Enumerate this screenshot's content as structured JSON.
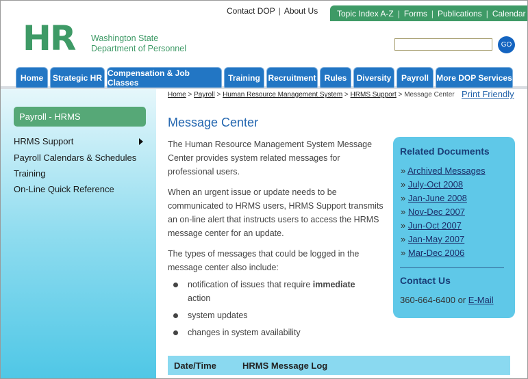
{
  "utility": {
    "contact": "Contact DOP",
    "about": "About Us",
    "sep": "|"
  },
  "greenbar": {
    "items": [
      "Topic Index A-Z",
      "Forms",
      "Publications",
      "Calendar"
    ]
  },
  "logo": {
    "mark": "HR",
    "line1": "Washington State",
    "line2": "Department of Personnel"
  },
  "search": {
    "value": "",
    "go_label": "GO"
  },
  "nav": {
    "tabs": [
      "Home",
      "Strategic HR",
      "Compensation & Job Classes",
      "Training",
      "Recruitment",
      "Rules",
      "Diversity",
      "Payroll",
      "More DOP Services"
    ]
  },
  "sidebar": {
    "active": "Payroll - HRMS",
    "items": [
      "HRMS Support",
      "Payroll Calendars & Schedules",
      "Training",
      "On-Line Quick Reference"
    ]
  },
  "breadcrumb": {
    "links": [
      "Home",
      "Payroll",
      "Human Resource Management System",
      "HRMS Support"
    ],
    "sep": " > ",
    "current": "Message Center"
  },
  "print_friendly": "Print Friendly",
  "page_title": "Message Center",
  "paragraphs": [
    "The Human Resource Management System Message Center provides system related messages for professional users.",
    "When an urgent issue or update needs to be communicated to HRMS users, HRMS Support transmits an on-line alert that instructs users to access the HRMS message center for an update.",
    "The types of messages that could be logged in the message center also include:"
  ],
  "bullets": [
    {
      "before": "notification of issues that require ",
      "bold": "immediate",
      "after": " action"
    },
    {
      "before": "system updates",
      "bold": "",
      "after": ""
    },
    {
      "before": "changes in system availability",
      "bold": "",
      "after": ""
    }
  ],
  "related": {
    "heading": "Related Documents",
    "marker": "»",
    "items": [
      "Archived Messages",
      "July-Oct 2008",
      "Jan-June 2008",
      "Nov-Dec 2007",
      "Jun-Oct 2007",
      "Jan-May 2007",
      "Mar-Dec 2006"
    ]
  },
  "contact": {
    "heading": "Contact Us",
    "phone": "360-664-6400",
    "or": " or ",
    "email_label": "E-Mail"
  },
  "table": {
    "col1": "Date/Time",
    "col2": "HRMS Message Log"
  },
  "colors": {
    "green": "#3e9a66",
    "nav_blue": "#2276c4",
    "title_blue": "#2467b0",
    "panel_cyan": "#5fc8e8"
  }
}
